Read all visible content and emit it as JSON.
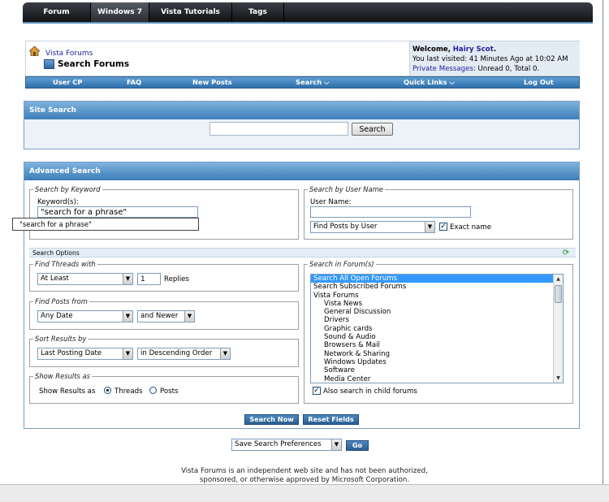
{
  "top_nav": {
    "tabs": [
      "Forum",
      "Windows 7",
      "Vista Tutorials",
      "Tags"
    ],
    "active": "Windows 7"
  },
  "breadcrumb": {
    "home": "Vista Forums",
    "title": "Search Forums"
  },
  "welcome": {
    "prefix": "Welcome,",
    "user": "Hairy Scot",
    "suffix": ".",
    "last_visit": "You last visited: 41 Minutes Ago at 10:02 AM",
    "pm_link": "Private Messages",
    "pm_counts": ": Unread 0, Total 0."
  },
  "navbar": [
    "User CP",
    "FAQ",
    "New Posts",
    "Search ⌵",
    "Quick Links ⌵",
    "Log Out"
  ],
  "site_search": {
    "title": "Site Search",
    "button": "Search",
    "value": ""
  },
  "advanced": {
    "title": "Advanced Search",
    "by_keyword": {
      "legend": "Search by Keyword",
      "label": "Keyword(s):",
      "value": "\"search for a phrase\"",
      "suggestion": "\"search for a phrase\""
    },
    "by_user": {
      "legend": "Search by User Name",
      "label": "User Name:",
      "value": "",
      "select": "Find Posts by User",
      "exact_label": "Exact name",
      "exact_checked": true
    },
    "options_title": "Search Options",
    "find_threads": {
      "legend": "Find Threads with",
      "select": "At Least",
      "replies": "1",
      "replies_label": "Replies"
    },
    "find_posts": {
      "legend": "Find Posts from",
      "select": "Any Date",
      "newer": "and Newer"
    },
    "sort": {
      "legend": "Sort Results by",
      "select": "Last Posting Date",
      "order": "in Descending Order"
    },
    "show_as": {
      "legend": "Show Results as",
      "label": "Show Results as",
      "threads": "Threads",
      "posts": "Posts",
      "selected": "Threads"
    },
    "forums": {
      "legend": "Search in Forum(s)",
      "items": [
        {
          "label": "Search All Open Forums",
          "selected": true,
          "indent": false
        },
        {
          "label": "Search Subscribed Forums",
          "selected": false,
          "indent": false
        },
        {
          "label": "Vista Forums",
          "selected": false,
          "indent": false
        },
        {
          "label": "Vista News",
          "selected": false,
          "indent": true
        },
        {
          "label": "General Discussion",
          "selected": false,
          "indent": true
        },
        {
          "label": "Drivers",
          "selected": false,
          "indent": true
        },
        {
          "label": "Graphic cards",
          "selected": false,
          "indent": true
        },
        {
          "label": "Sound & Audio",
          "selected": false,
          "indent": true
        },
        {
          "label": "Browsers & Mail",
          "selected": false,
          "indent": true
        },
        {
          "label": "Network & Sharing",
          "selected": false,
          "indent": true
        },
        {
          "label": "Windows Updates",
          "selected": false,
          "indent": true
        },
        {
          "label": "Software",
          "selected": false,
          "indent": true
        },
        {
          "label": "Media Center",
          "selected": false,
          "indent": true
        }
      ],
      "child_label": "Also search in child forums",
      "child_checked": true
    },
    "search_now": "Search Now",
    "reset": "Reset Fields"
  },
  "preferences": {
    "select": "Save Search Preferences",
    "go": "Go"
  },
  "footer": {
    "line1": "Vista Forums is an independent web site and has not been authorized,",
    "line2": "sponsored, or otherwise approved by Microsoft Corporation."
  },
  "colors": {
    "header_blue": "#3c7db8",
    "link": "#22229c",
    "topbar": "#101214",
    "list_selection": "#3399ff"
  }
}
